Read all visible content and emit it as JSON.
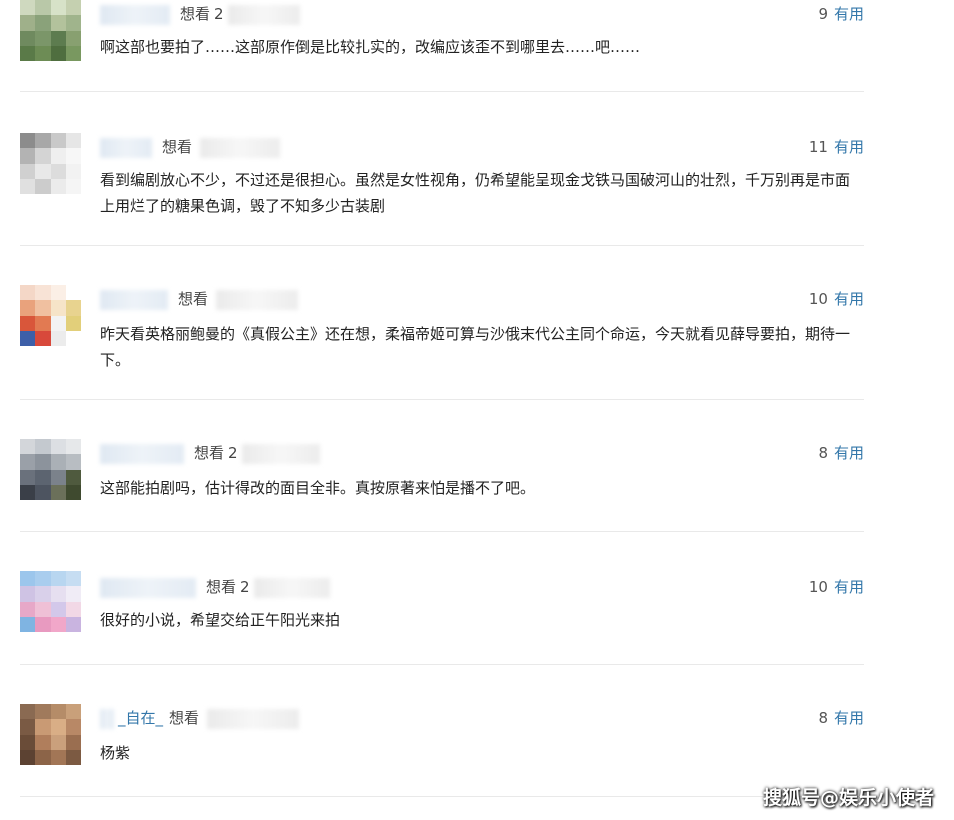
{
  "comments": [
    {
      "user": "",
      "status": "想看",
      "time": "2",
      "votes": "9",
      "useful_label": "有用",
      "text": "啊这部也要拍了……这部原作倒是比较扎实的，改编应该歪不到哪里去……吧……"
    },
    {
      "user": "",
      "status": "想看",
      "time": "",
      "votes": "11",
      "useful_label": "有用",
      "text": "看到编剧放心不少，不过还是很担心。虽然是女性视角，仍希望能呈现金戈铁马国破河山的壮烈，千万别再是市面上用烂了的糖果色调，毁了不知多少古装剧"
    },
    {
      "user": "",
      "status": "想看",
      "time": "",
      "votes": "10",
      "useful_label": "有用",
      "text": "昨天看英格丽鲍曼的《真假公主》还在想，柔福帝姬可算与沙俄末代公主同个命运，今天就看见薛导要拍，期待一下。"
    },
    {
      "user": "",
      "status": "想看",
      "time": "2",
      "votes": "8",
      "useful_label": "有用",
      "text": "这部能拍剧吗，估计得改的面目全非。真按原著来怕是播不了吧。"
    },
    {
      "user": "",
      "status": "想看",
      "time": "2",
      "votes": "10",
      "useful_label": "有用",
      "text": "很好的小说，希望交给正午阳光来拍"
    },
    {
      "user": "_自在_",
      "status": "想看",
      "time": "",
      "votes": "8",
      "useful_label": "有用",
      "text": "杨紫"
    }
  ],
  "watermark": "搜狐号@娱乐小使者",
  "colors": {
    "link": "#3377aa",
    "divider": "#e9e9e9",
    "text": "#222222"
  }
}
